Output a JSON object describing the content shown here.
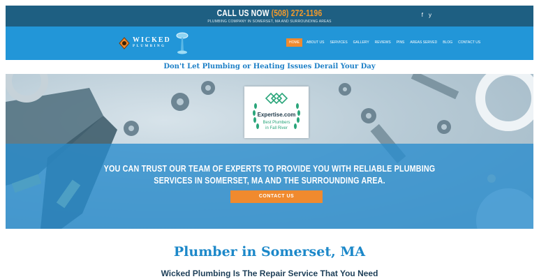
{
  "topbar": {
    "call_label": "CALL US NOW",
    "phone": "(508) 272-1196",
    "tagline": "PLUMBING COMPANY IN SOMERSET, MA AND SURROUNDING AREAS",
    "social": [
      "f",
      "y"
    ]
  },
  "logo": {
    "name": "WICKED",
    "sub": "PLUMBING"
  },
  "nav": {
    "items": [
      "Home",
      "About Us",
      "Services",
      "Gallery",
      "Reviews",
      "Pins",
      "Areas Served",
      "Blog",
      "Contact Us"
    ],
    "active_index": 0
  },
  "slogan": "Don't Let Plumbing or Heating Issues Derail Your Day",
  "hero": {
    "badge": {
      "brand": "Expertise.com",
      "line1": "Best Plumbers",
      "line2": "in Fall River"
    },
    "text_line1": "YOU CAN TRUST OUR TEAM OF EXPERTS TO PROVIDE YOU WITH RELIABLE PLUMBING",
    "text_line2": "SERVICES IN SOMERSET, MA AND THE SURROUNDING AREA.",
    "cta": "CONTACT US"
  },
  "content": {
    "heading": "Plumber in Somerset, MA",
    "subheading": "Wicked Plumbing Is The Repair Service That You Need"
  },
  "colors": {
    "topbar": "#1e5f82",
    "navbar": "#2296d8",
    "accent": "#f08a2e",
    "heading": "#1c88c9"
  }
}
